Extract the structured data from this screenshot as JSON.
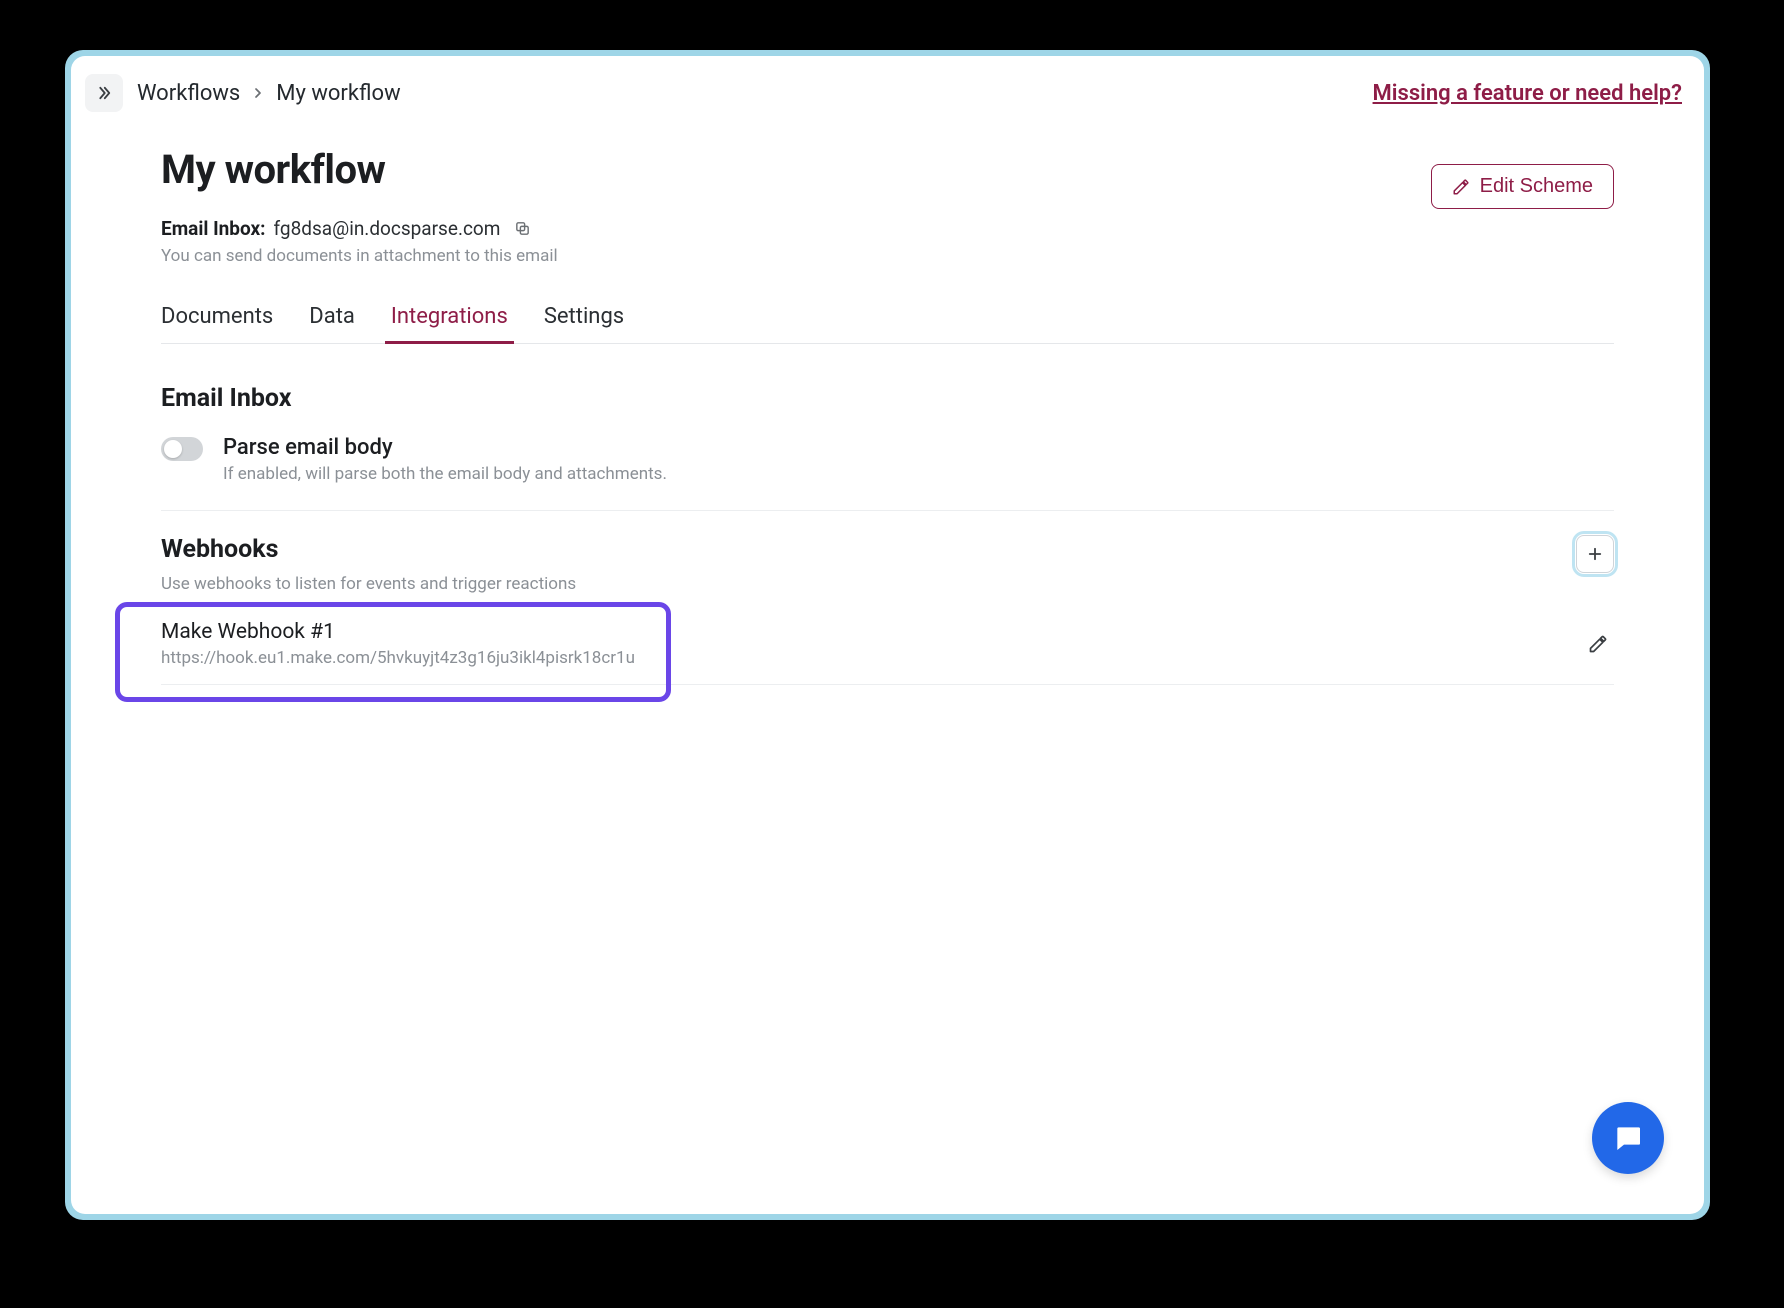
{
  "breadcrumb": {
    "parent": "Workflows",
    "current": "My workflow"
  },
  "help_link": "Missing a feature or need help?",
  "page_title": "My workflow",
  "email_inbox": {
    "label": "Email Inbox:",
    "value": "fg8dsa@in.docsparse.com",
    "hint": "You can send documents in attachment to this email"
  },
  "edit_scheme_label": "Edit Scheme",
  "tabs": {
    "documents": "Documents",
    "data": "Data",
    "integrations": "Integrations",
    "settings": "Settings"
  },
  "email_inbox_section": {
    "title": "Email Inbox",
    "toggle_title": "Parse email body",
    "toggle_desc": "If enabled, will parse both the email body and attachments."
  },
  "webhooks_section": {
    "title": "Webhooks",
    "sub": "Use webhooks to listen for events and trigger reactions",
    "items": [
      {
        "name": "Make Webhook #1",
        "url": "https://hook.eu1.make.com/5hvkuyjt4z3g16ju3ikl4pisrk18cr1u"
      }
    ]
  },
  "colors": {
    "accent": "#8e1d47",
    "highlight": "#6a46e8",
    "frame": "#9ed5e7",
    "fab": "#2268e8"
  }
}
